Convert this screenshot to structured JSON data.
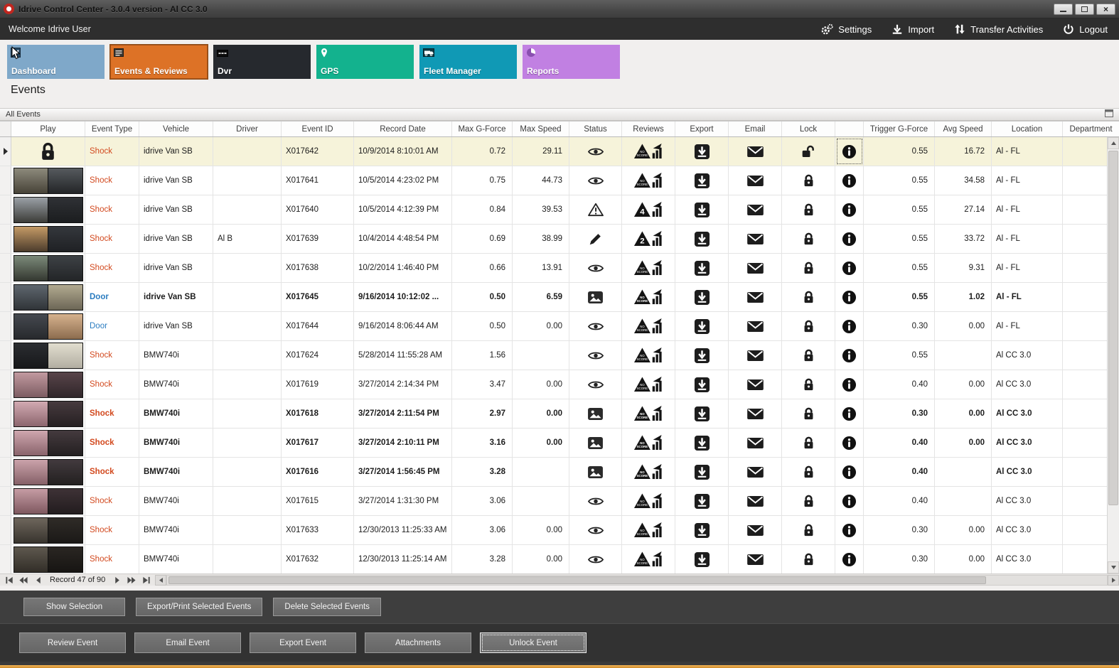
{
  "window": {
    "title": "Idrive Control Center - 3.0.4 version - Al CC 3.0",
    "caption_buttons": [
      "minimize",
      "maximize",
      "close"
    ]
  },
  "topbar": {
    "welcome": "Welcome Idrive User",
    "actions": [
      {
        "icon": "settings-gears-icon",
        "label": "Settings"
      },
      {
        "icon": "import-icon",
        "label": "Import"
      },
      {
        "icon": "transfer-activities-icon",
        "label": "Transfer Activities"
      },
      {
        "icon": "logout-power-icon",
        "label": "Logout"
      }
    ]
  },
  "nav_tiles": [
    {
      "label": "Dashboard",
      "icon": "dashboard-icon",
      "color": "#7fa8c9",
      "selected": false
    },
    {
      "label": "Events & Reviews",
      "icon": "events-list-icon",
      "color": "#dd7226",
      "selected": true
    },
    {
      "label": "Dvr",
      "icon": "dvr-icon",
      "color": "#26292e",
      "selected": false
    },
    {
      "label": "GPS",
      "icon": "gps-pin-icon",
      "color": "#13b28e",
      "selected": false
    },
    {
      "label": "Fleet Manager",
      "icon": "fleet-manager-icon",
      "color": "#1099b5",
      "selected": false
    },
    {
      "label": "Reports",
      "icon": "reports-pie-icon",
      "color": "#c180e2",
      "selected": false
    }
  ],
  "page": {
    "title": "Events",
    "group_header": "All Events"
  },
  "palette": {
    "shock": "#d2491e",
    "door": "#2b7cc0",
    "selected_row_bg": "#f6f3da",
    "accent_bottom": "#dfa041"
  },
  "table": {
    "columns": [
      "",
      "Play",
      "Event Type",
      "Vehicle",
      "Driver",
      "Event ID",
      "Record Date",
      "Max G-Force",
      "Max Speed",
      "Status",
      "Reviews",
      "Export",
      "Email",
      "Lock",
      "",
      "Trigger G-Force",
      "Avg Speed",
      "Location",
      "Department"
    ],
    "rows": [
      {
        "selected": true,
        "bold": false,
        "play": "lock",
        "locked": false,
        "info_focus": true,
        "type": "Shock",
        "vehicle": "idrive Van SB",
        "driver": "",
        "event_id": "X017642",
        "record_date": "10/9/2014 8:10:01 AM",
        "max_g": "0.72",
        "max_speed": "29.11",
        "status": "eye",
        "review_badge": "NO SCORE",
        "trigger_g": "0.55",
        "avg_speed": "16.72",
        "location": "Al - FL",
        "department": "",
        "thumb": null
      },
      {
        "selected": false,
        "bold": false,
        "play": "thumb",
        "locked": true,
        "type": "Shock",
        "vehicle": "idrive Van SB",
        "driver": "",
        "event_id": "X017641",
        "record_date": "10/5/2014 4:23:02 PM",
        "max_g": "0.75",
        "max_speed": "44.73",
        "status": "eye",
        "review_badge": "NO SCORE",
        "trigger_g": "0.55",
        "avg_speed": "34.58",
        "location": "Al - FL",
        "department": "",
        "thumb": [
          [
            "#8d8a7c",
            "#474338"
          ],
          [
            "#565a5e",
            "#232527"
          ]
        ]
      },
      {
        "selected": false,
        "bold": false,
        "play": "thumb",
        "locked": true,
        "type": "Shock",
        "vehicle": "idrive Van SB",
        "driver": "",
        "event_id": "X017640",
        "record_date": "10/5/2014 4:12:39 PM",
        "max_g": "0.84",
        "max_speed": "39.53",
        "status": "alert",
        "review_badge": "4",
        "trigger_g": "0.55",
        "avg_speed": "27.14",
        "location": "Al - FL",
        "department": "",
        "thumb": [
          [
            "#9aa0a6",
            "#3c3c38"
          ],
          [
            "#2f3135",
            "#1b1d1f"
          ]
        ]
      },
      {
        "selected": false,
        "bold": false,
        "play": "thumb",
        "locked": true,
        "type": "Shock",
        "vehicle": "idrive Van SB",
        "driver": "Al B",
        "event_id": "X017639",
        "record_date": "10/4/2014 4:48:54 PM",
        "max_g": "0.69",
        "max_speed": "38.99",
        "status": "pencil",
        "review_badge": "2",
        "trigger_g": "0.55",
        "avg_speed": "33.72",
        "location": "Al - FL",
        "department": "",
        "thumb": [
          [
            "#c49a66",
            "#4c3c2c"
          ],
          [
            "#34373c",
            "#1f2124"
          ]
        ]
      },
      {
        "selected": false,
        "bold": false,
        "play": "thumb",
        "locked": true,
        "type": "Shock",
        "vehicle": "idrive Van SB",
        "driver": "",
        "event_id": "X017638",
        "record_date": "10/2/2014 1:46:40 PM",
        "max_g": "0.66",
        "max_speed": "13.91",
        "status": "eye",
        "review_badge": "NO SCORE",
        "trigger_g": "0.55",
        "avg_speed": "9.31",
        "location": "Al - FL",
        "department": "",
        "thumb": [
          [
            "#7c8a7a",
            "#343830"
          ],
          [
            "#3d4145",
            "#232527"
          ]
        ]
      },
      {
        "selected": false,
        "bold": true,
        "play": "thumb",
        "locked": true,
        "type": "Door",
        "vehicle": "idrive Van SB",
        "driver": "",
        "event_id": "X017645",
        "record_date": "9/16/2014 10:12:02 ...",
        "max_g": "0.50",
        "max_speed": "6.59",
        "status": "photo",
        "review_badge": "NO SCORE",
        "trigger_g": "0.55",
        "avg_speed": "1.02",
        "location": "Al - FL",
        "department": "",
        "thumb": [
          [
            "#5e666e",
            "#303438"
          ],
          [
            "#b2aa90",
            "#6c6656"
          ]
        ]
      },
      {
        "selected": false,
        "bold": false,
        "play": "thumb",
        "locked": true,
        "type": "Door",
        "vehicle": "idrive Van SB",
        "driver": "",
        "event_id": "X017644",
        "record_date": "9/16/2014 8:06:44 AM",
        "max_g": "0.50",
        "max_speed": "0.00",
        "status": "eye",
        "review_badge": "NO SCORE",
        "trigger_g": "0.30",
        "avg_speed": "0.00",
        "location": "Al - FL",
        "department": "",
        "thumb": [
          [
            "#45494f",
            "#27292d"
          ],
          [
            "#d6b28e",
            "#8c6c4e"
          ]
        ]
      },
      {
        "selected": false,
        "bold": false,
        "play": "thumb",
        "locked": true,
        "type": "Shock",
        "vehicle": "BMW740i",
        "driver": "",
        "event_id": "X017624",
        "record_date": "5/28/2014 11:55:28 AM",
        "max_g": "1.56",
        "max_speed": "",
        "status": "eye",
        "review_badge": "NO SCORE",
        "trigger_g": "0.55",
        "avg_speed": "",
        "location": "Al CC 3.0",
        "department": "",
        "thumb": [
          [
            "#2b2d31",
            "#17181a"
          ],
          [
            "#e2decf",
            "#b2aea2"
          ]
        ]
      },
      {
        "selected": false,
        "bold": false,
        "play": "thumb",
        "locked": true,
        "type": "Shock",
        "vehicle": "BMW740i",
        "driver": "",
        "event_id": "X017619",
        "record_date": "3/27/2014 2:14:34 PM",
        "max_g": "3.47",
        "max_speed": "0.00",
        "status": "eye",
        "review_badge": "NO SCORE",
        "trigger_g": "0.40",
        "avg_speed": "0.00",
        "location": "Al CC 3.0",
        "department": "",
        "thumb": [
          [
            "#c29aa0",
            "#7c5c62"
          ],
          [
            "#584449",
            "#30262a"
          ]
        ]
      },
      {
        "selected": false,
        "bold": true,
        "play": "thumb",
        "locked": true,
        "type": "Shock",
        "vehicle": "BMW740i",
        "driver": "",
        "event_id": "X017618",
        "record_date": "3/27/2014 2:11:54 PM",
        "max_g": "2.97",
        "max_speed": "0.00",
        "status": "photo",
        "review_badge": "NO SCORE",
        "trigger_g": "0.30",
        "avg_speed": "0.00",
        "location": "Al CC 3.0",
        "department": "",
        "thumb": [
          [
            "#d2aab2",
            "#8c666e"
          ],
          [
            "#463a3e",
            "#262022"
          ]
        ]
      },
      {
        "selected": false,
        "bold": true,
        "play": "thumb",
        "locked": true,
        "type": "Shock",
        "vehicle": "BMW740i",
        "driver": "",
        "event_id": "X017617",
        "record_date": "3/27/2014 2:10:11 PM",
        "max_g": "3.16",
        "max_speed": "0.00",
        "status": "photo",
        "review_badge": "NO SCORE",
        "trigger_g": "0.40",
        "avg_speed": "0.00",
        "location": "Al CC 3.0",
        "department": "",
        "thumb": [
          [
            "#cfa7af",
            "#89636b"
          ],
          [
            "#443a3e",
            "#242021"
          ]
        ]
      },
      {
        "selected": false,
        "bold": true,
        "play": "thumb",
        "locked": true,
        "type": "Shock",
        "vehicle": "BMW740i",
        "driver": "",
        "event_id": "X017616",
        "record_date": "3/27/2014 1:56:45 PM",
        "max_g": "3.28",
        "max_speed": "",
        "status": "photo",
        "review_badge": "NO SCORE",
        "trigger_g": "0.40",
        "avg_speed": "",
        "location": "Al CC 3.0",
        "department": "",
        "thumb": [
          [
            "#cba3ab",
            "#856067"
          ],
          [
            "#423a3e",
            "#232020"
          ]
        ]
      },
      {
        "selected": false,
        "bold": false,
        "play": "thumb",
        "locked": true,
        "type": "Shock",
        "vehicle": "BMW740i",
        "driver": "",
        "event_id": "X017615",
        "record_date": "3/27/2014 1:31:30 PM",
        "max_g": "3.06",
        "max_speed": "",
        "status": "eye",
        "review_badge": "NO SCORE",
        "trigger_g": "0.40",
        "avg_speed": "",
        "location": "Al CC 3.0",
        "department": "",
        "thumb": [
          [
            "#c69ca4",
            "#7e585f"
          ],
          [
            "#3e3236",
            "#221c1e"
          ]
        ]
      },
      {
        "selected": false,
        "bold": false,
        "play": "thumb",
        "locked": true,
        "type": "Shock",
        "vehicle": "BMW740i",
        "driver": "",
        "event_id": "X017633",
        "record_date": "12/30/2013 11:25:33 AM",
        "max_g": "3.06",
        "max_speed": "0.00",
        "status": "eye",
        "review_badge": "NO SCORE",
        "trigger_g": "0.30",
        "avg_speed": "0.00",
        "location": "Al CC 3.0",
        "department": "",
        "thumb": [
          [
            "#6e665c",
            "#38342e"
          ],
          [
            "#2f2b27",
            "#1b1917"
          ]
        ]
      },
      {
        "selected": false,
        "bold": false,
        "play": "thumb",
        "locked": true,
        "type": "Shock",
        "vehicle": "BMW740i",
        "driver": "",
        "event_id": "X017632",
        "record_date": "12/30/2013 11:25:14 AM",
        "max_g": "3.28",
        "max_speed": "0.00",
        "status": "eye",
        "review_badge": "NO SCORE",
        "trigger_g": "0.30",
        "avg_speed": "0.00",
        "location": "Al CC 3.0",
        "department": "",
        "thumb": [
          [
            "#5e584e",
            "#322e28"
          ],
          [
            "#2a2622",
            "#171513"
          ]
        ]
      }
    ]
  },
  "record_nav": {
    "text": "Record 47 of 90"
  },
  "selection_bar": {
    "buttons": [
      "Show Selection",
      "Export/Print Selected Events",
      "Delete Selected Events"
    ]
  },
  "event_bar": {
    "buttons": [
      "Review Event",
      "Email Event",
      "Export Event",
      "Attachments",
      "Unlock Event"
    ],
    "focused": "Unlock Event"
  }
}
